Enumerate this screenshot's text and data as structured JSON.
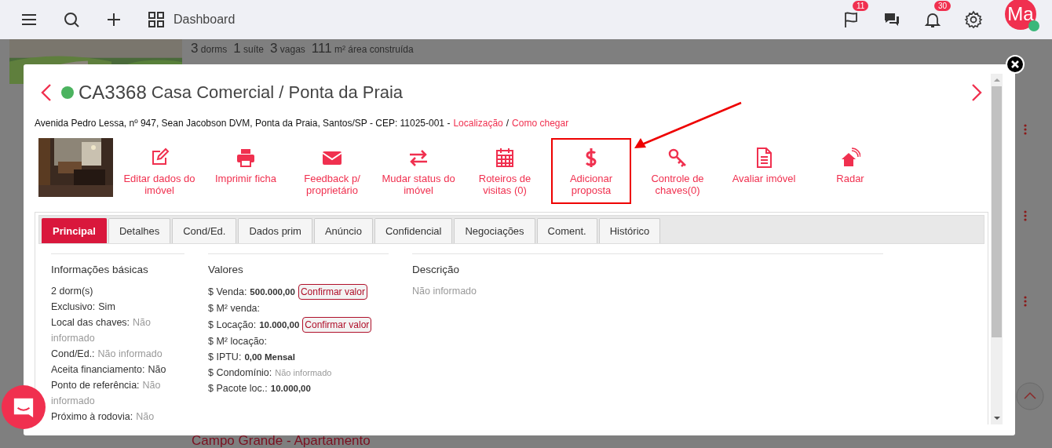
{
  "topbar": {
    "dashboard_label": "Dashboard",
    "flag_badge": "11",
    "bell_badge": "30",
    "avatar": {
      "initials": "Ma",
      "online": true
    }
  },
  "background": {
    "listing_stats": [
      {
        "num": "3",
        "unit": "dorms"
      },
      {
        "num": "1",
        "unit": "suíte"
      },
      {
        "num": "3",
        "unit": "vagas"
      },
      {
        "num": "111",
        "unit": "m² área construída"
      }
    ],
    "next_listing_title": "Campo Grande - Apartamento"
  },
  "modal": {
    "code": "CA3368",
    "active": true,
    "title": "Casa Comercial / Ponta da Praia",
    "address": "Avenida Pedro Lessa, nº 947, Sean Jacobson DVM, Ponta da Praia, Santos/SP - CEP: 11025-001 -",
    "links": [
      "Localização",
      "Como chegar"
    ],
    "link_separator": "/",
    "actions": [
      {
        "label": "Editar dados do imóvel",
        "highlighted": false
      },
      {
        "label": "Imprimir ficha",
        "highlighted": false
      },
      {
        "label": "Feedback p/ proprietário",
        "highlighted": false
      },
      {
        "label": "Mudar status do imóvel",
        "highlighted": false
      },
      {
        "label": "Roteiros de visitas (0)",
        "highlighted": false
      },
      {
        "label": "Adicionar proposta",
        "highlighted": true
      },
      {
        "label": "Controle de chaves(0)",
        "highlighted": false
      },
      {
        "label": "Avaliar imóvel",
        "highlighted": false
      },
      {
        "label": "Radar",
        "highlighted": false
      }
    ],
    "tabs": [
      {
        "label": "Principal",
        "selected": true
      },
      {
        "label": "Detalhes",
        "selected": false
      },
      {
        "label": "Cond/Ed.",
        "selected": false
      },
      {
        "label": "Dados prim",
        "selected": false
      },
      {
        "label": "Anúncio",
        "selected": false
      },
      {
        "label": "Confidencial",
        "selected": false
      },
      {
        "label": "Negociações",
        "selected": false
      },
      {
        "label": "Coment.",
        "selected": false
      },
      {
        "label": "Histórico",
        "selected": false
      }
    ],
    "basic": {
      "heading": "Informações básicas",
      "items": [
        {
          "label": "2 dorm(s)"
        },
        {
          "label": "Exclusivo:",
          "value": "Sim",
          "muted": false
        },
        {
          "label": "Local das chaves:",
          "value": "Não informado",
          "muted": true
        },
        {
          "label": "Cond/Ed.:",
          "value": "Não informado",
          "muted": true
        },
        {
          "label": "Aceita financiamento:",
          "value": "Não",
          "muted": false
        },
        {
          "label": "Ponto de referência:",
          "value": "Não informado",
          "muted": true
        },
        {
          "label": "Próximo à rodovia:",
          "value": "Não",
          "muted": true
        }
      ]
    },
    "values": {
      "heading": "Valores",
      "items": [
        {
          "label": "$ Venda:",
          "value": "500.000,00",
          "muted": false,
          "button": "Confirmar valor"
        },
        {
          "label": "$ M² venda:"
        },
        {
          "label": "$ Locação:",
          "value": "10.000,00",
          "muted": false,
          "button": "Confirmar valor"
        },
        {
          "label": "$ M² locação:"
        },
        {
          "label": "$ IPTU:",
          "value": "0,00 Mensal",
          "muted": false
        },
        {
          "label": "$ Condomínio:",
          "value": "Não informado",
          "muted": true
        },
        {
          "label": "$ Pacote loc.:",
          "value": "10.000,00",
          "muted": false
        }
      ]
    },
    "description": {
      "heading": "Descrição",
      "text": "Não informado"
    }
  }
}
